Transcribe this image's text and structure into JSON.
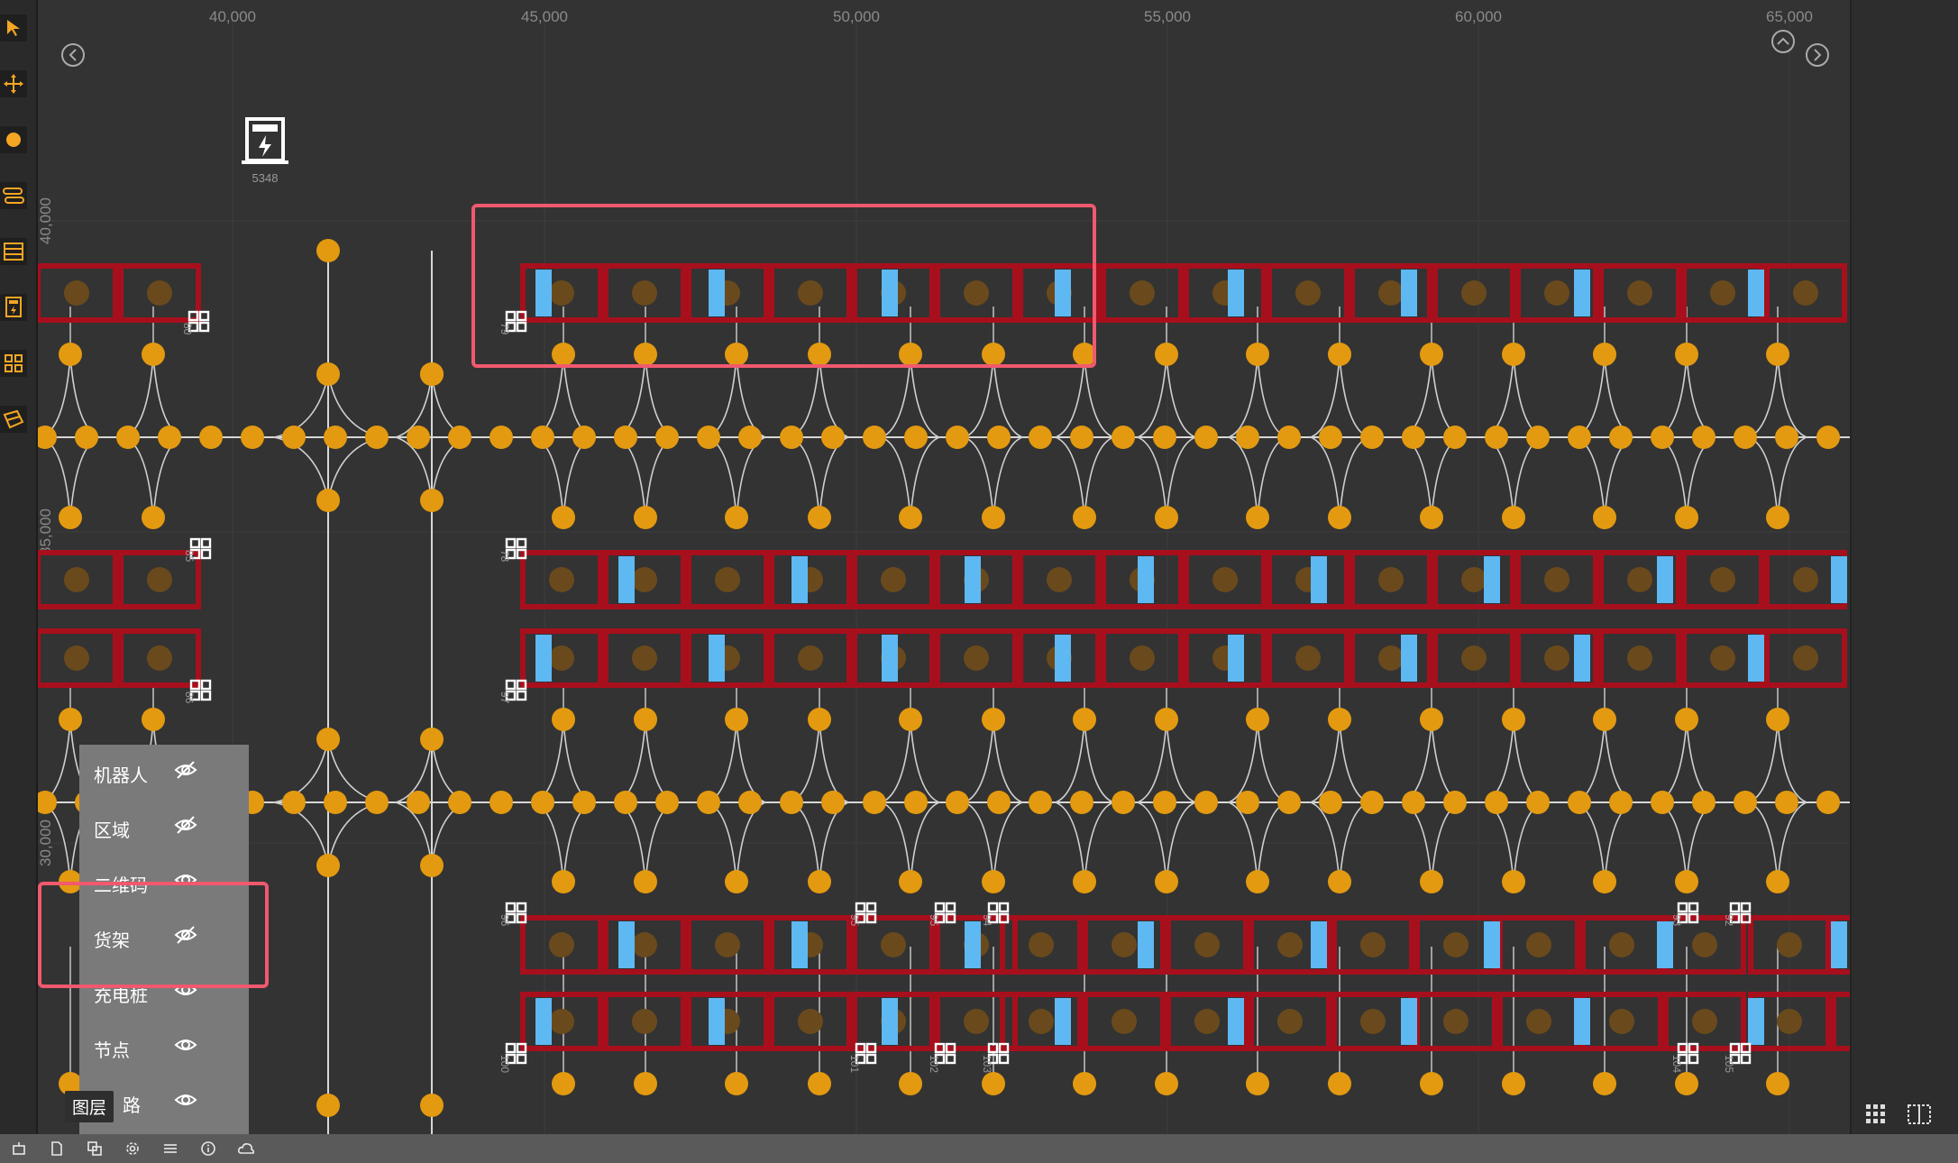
{
  "canvas": {
    "x_ruler": [
      "40,000",
      "45,000",
      "50,000",
      "55,000",
      "60,000",
      "65,000"
    ],
    "y_ruler": [
      "40,000",
      "35,000",
      "30,000"
    ],
    "charging_station_id": "5348",
    "qr_labels": {
      "r1": [
        "80",
        "79"
      ],
      "r2": [
        "85",
        "78"
      ],
      "r3": [
        "86",
        "97"
      ],
      "r4": [
        "96",
        "95",
        "95",
        "94",
        "93",
        "92"
      ],
      "r5": [
        "100",
        "101",
        "102",
        "103",
        "104",
        "105"
      ]
    }
  },
  "toolbar": {
    "tools": [
      "select-tool",
      "move-tool",
      "node-tool",
      "path-tool",
      "shelf-tool",
      "charger-tool",
      "qrcode-tool",
      "area-tool"
    ]
  },
  "layers": {
    "items": [
      {
        "label": "机器人",
        "visible": false
      },
      {
        "label": "区域",
        "visible": false
      },
      {
        "label": "二维码",
        "visible": true
      },
      {
        "label": "货架",
        "visible": false
      },
      {
        "label": "充电桩",
        "visible": true
      },
      {
        "label": "节点",
        "visible": true
      },
      {
        "label": "路",
        "visible": true
      }
    ],
    "tooltip": "图层"
  },
  "statusbar": {
    "icons": [
      "robot-icon",
      "document-icon",
      "layers-icon",
      "settings-icon",
      "list-icon",
      "info-icon",
      "cloud-icon"
    ]
  },
  "colors": {
    "background": "#333333",
    "node": "#e39a10",
    "shelf": "#a80f1d",
    "shelf_slot": "#6a4a1c",
    "blue_marker": "#5eb8f2",
    "highlight": "#f0596e",
    "road": "#d8d8d8"
  }
}
